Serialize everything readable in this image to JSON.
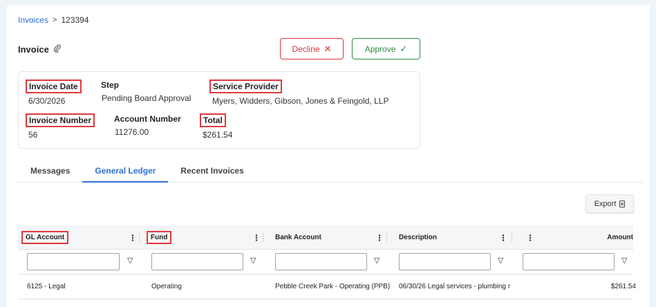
{
  "breadcrumb": {
    "parent": "Invoices",
    "separator": ">",
    "current": "123394"
  },
  "header": {
    "title": "Invoice",
    "attach_icon": "paperclip-icon"
  },
  "actions": {
    "decline_label": "Decline",
    "decline_icon": "✕",
    "approve_label": "Approve",
    "approve_icon": "✓"
  },
  "details": {
    "invoice_date_label": "Invoice Date",
    "invoice_date": "6/30/2026",
    "step_label": "Step",
    "step": "Pending Board Approval",
    "service_provider_label": "Service Provider",
    "service_provider": "Myers, Widders, Gibson, Jones & Feingold, LLP",
    "invoice_number_label": "Invoice Number",
    "invoice_number": "56",
    "account_number_label": "Account Number",
    "account_number": "11276.00",
    "total_label": "Total",
    "total": "$261.54"
  },
  "tabs": [
    {
      "label": "Messages"
    },
    {
      "label": "General Ledger"
    },
    {
      "label": "Recent Invoices"
    }
  ],
  "toolbar": {
    "export_label": "Export"
  },
  "grid": {
    "columns": [
      {
        "label": "GL Account"
      },
      {
        "label": "Fund"
      },
      {
        "label": "Bank Account"
      },
      {
        "label": "Description"
      },
      {
        "label": "Amount"
      }
    ],
    "rows": [
      {
        "gl_account": "6125 - Legal",
        "fund": "Operating",
        "bank_account": "Pebble Creek Park - Operating (PPB)",
        "description": "06/30/26 Legal services - plumbing r",
        "amount": "$261.54"
      }
    ]
  },
  "colors": {
    "link": "#2f6fd6",
    "decline": "#d9363e",
    "approve": "#2e8b3e",
    "highlight": "#e0383e"
  }
}
